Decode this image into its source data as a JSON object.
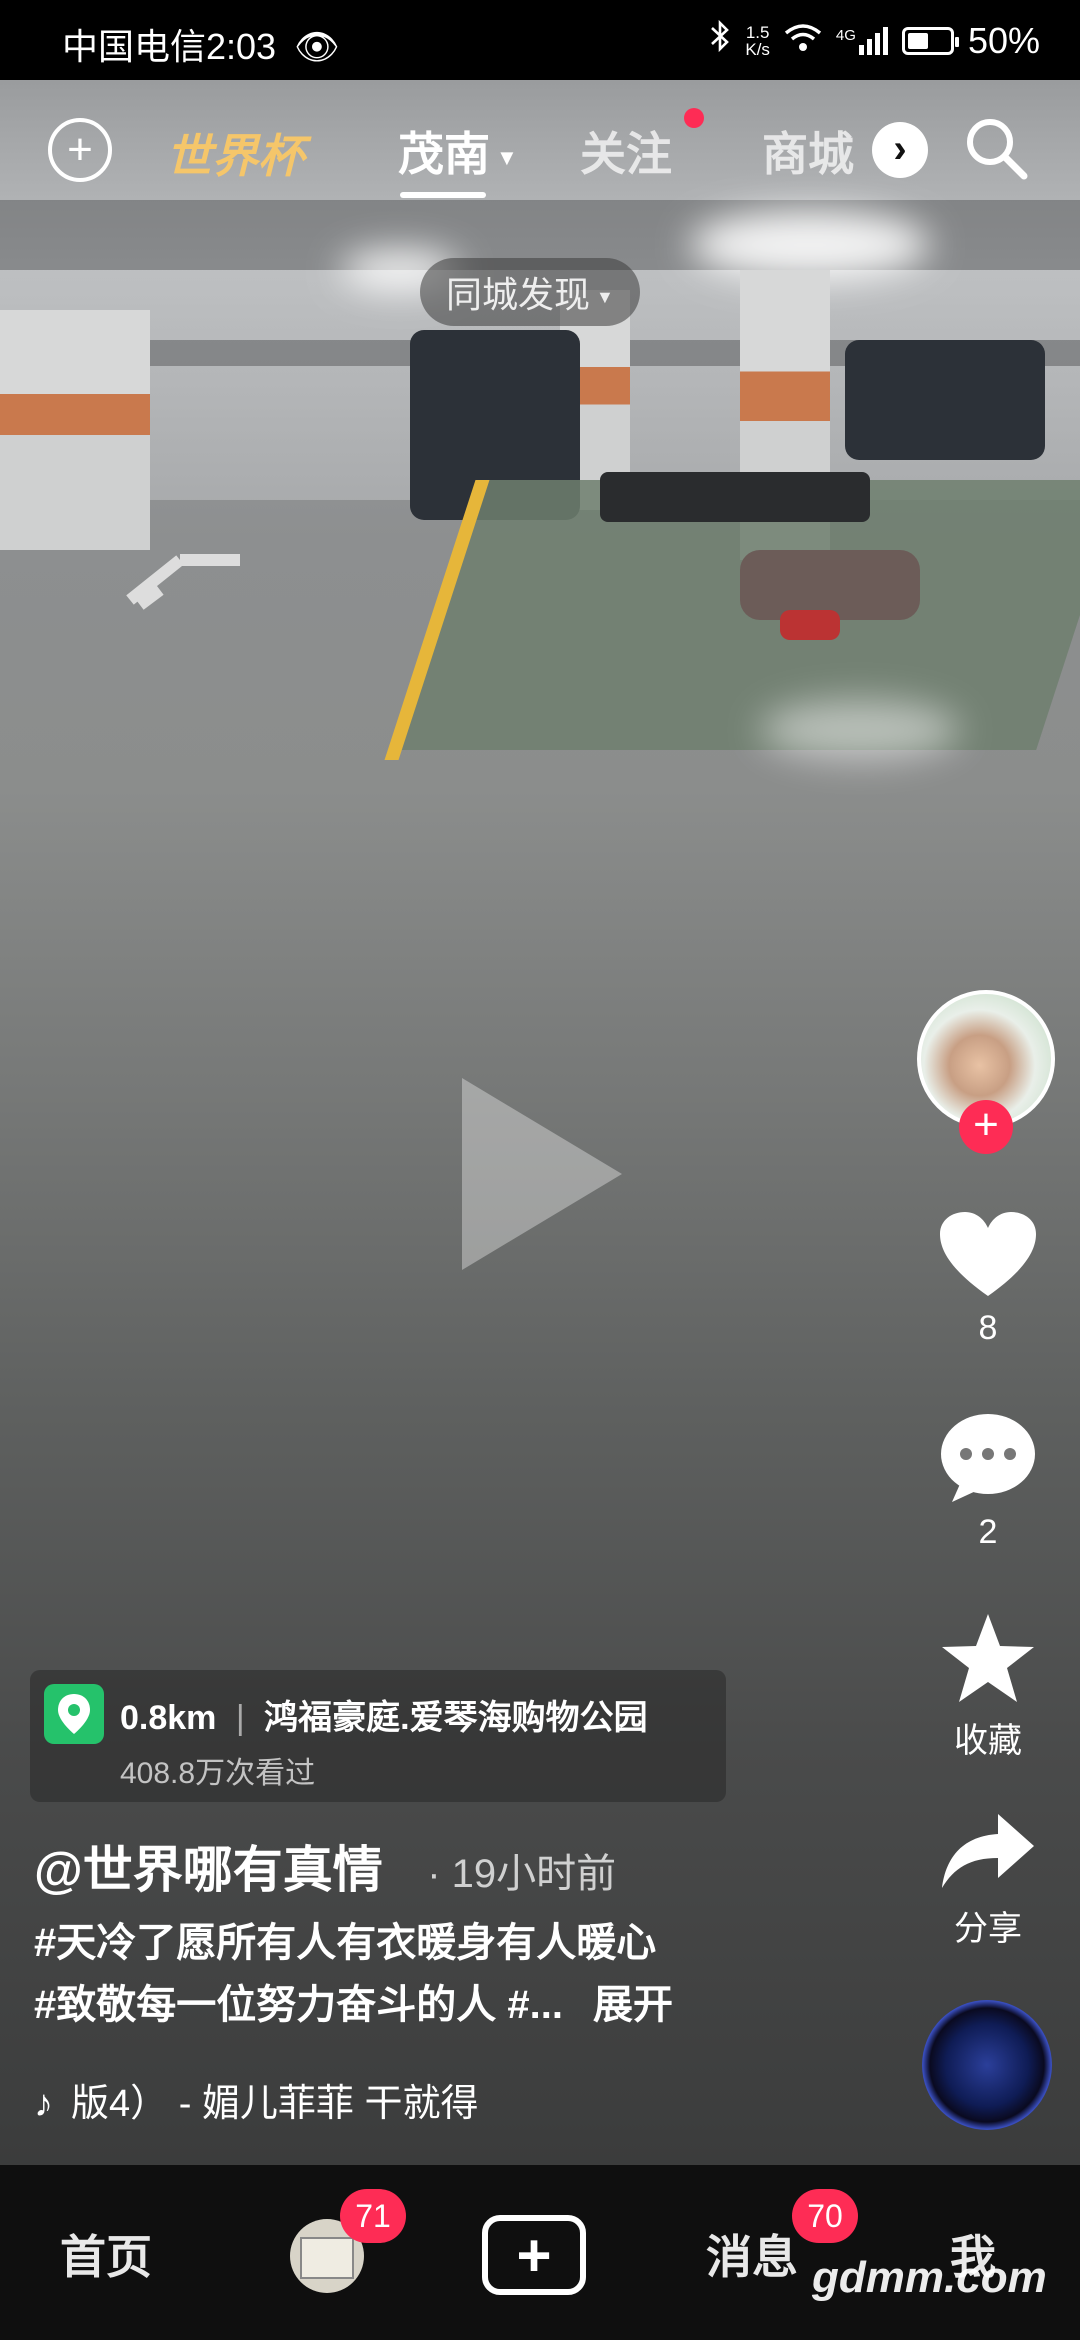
{
  "status": {
    "carrier_time": "中国电信2:03",
    "net_speed_value": "1.5",
    "net_speed_unit": "K/s",
    "signal_label": "4G",
    "battery_percent": "50%",
    "battery_level": 0.5
  },
  "top_nav": {
    "world_cup": "世界杯",
    "tabs": [
      {
        "label": "茂南",
        "active": true
      },
      {
        "label": "关注",
        "active": false
      },
      {
        "label": "商城",
        "active": false
      }
    ],
    "dropdown": "同城发现"
  },
  "rail": {
    "likes": "8",
    "comments": "2",
    "favorite": "收藏",
    "share": "分享"
  },
  "location": {
    "distance": "0.8km",
    "name": "鸿福豪庭.爱琴海购物公园",
    "views": "408.8万次看过"
  },
  "post": {
    "author": "@世界哪有真情",
    "time": "· 19小时前",
    "caption_line1": "#天冷了愿所有人有衣暖身有人暖心",
    "caption_line2": "#致敬每一位努力奋斗的人 #...",
    "expand": "展开",
    "music": "版4） - 媚儿菲菲    干就得"
  },
  "bottom_nav": {
    "home": "首页",
    "friends_badge": "71",
    "messages": "消息",
    "messages_badge": "70",
    "me": "我"
  },
  "watermark": "gdmm.com",
  "colors": {
    "accent": "#fe2c55",
    "location_green": "#25c26b"
  }
}
